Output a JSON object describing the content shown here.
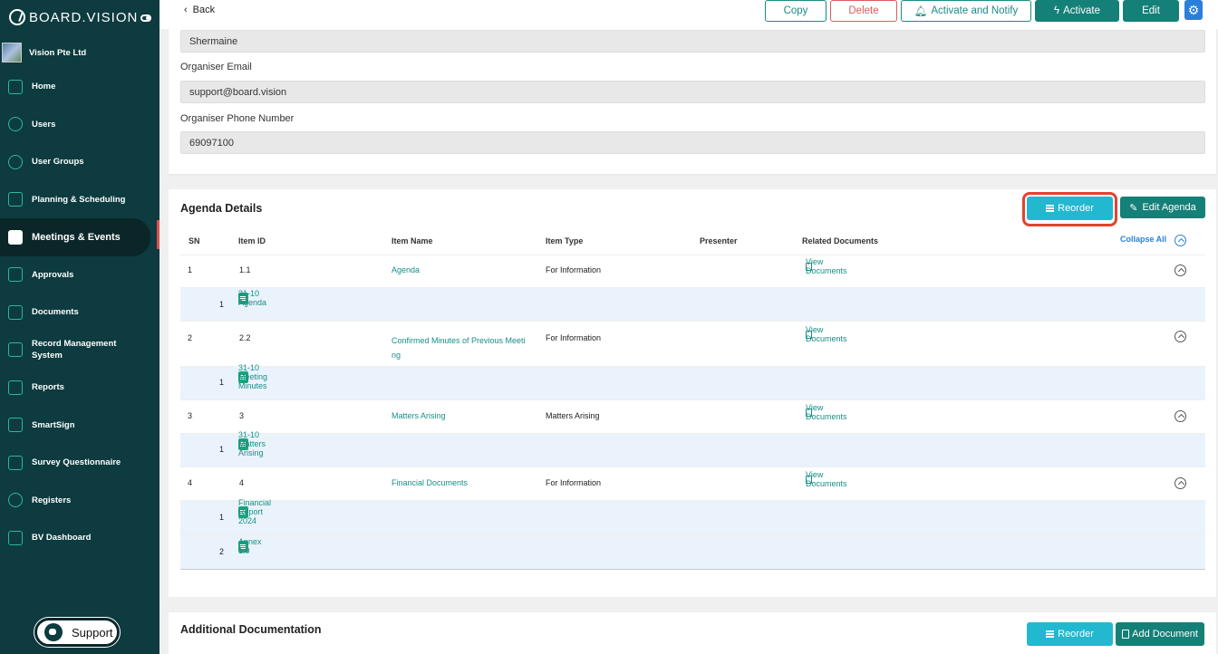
{
  "sidebar": {
    "logo": "BOARD.VISION",
    "org": "Vision Pte Ltd",
    "items": [
      {
        "label": "Home",
        "icon": "home-icon"
      },
      {
        "label": "Users",
        "icon": "user-icon"
      },
      {
        "label": "User Groups",
        "icon": "user-group-icon"
      },
      {
        "label": "Planning & Scheduling",
        "icon": "chart-icon"
      },
      {
        "label": "Meetings & Events",
        "icon": "calendar-icon"
      },
      {
        "label": "Approvals",
        "icon": "document-icon"
      },
      {
        "label": "Documents",
        "icon": "documents-icon"
      },
      {
        "label": "Record Management System",
        "icon": "records-icon"
      },
      {
        "label": "Reports",
        "icon": "report-icon"
      },
      {
        "label": "SmartSign",
        "icon": "signature-icon"
      },
      {
        "label": "Survey Questionnaire",
        "icon": "survey-icon"
      },
      {
        "label": "Registers",
        "icon": "registered-icon"
      },
      {
        "label": "BV Dashboard",
        "icon": "dashboard-icon"
      }
    ],
    "support_label": "Support"
  },
  "topbar": {
    "back_label": "Back",
    "copy_label": "Copy",
    "delete_label": "Delete",
    "notify_label": "Activate and Notify",
    "activate_label": "Activate",
    "edit_label": "Edit"
  },
  "organiser": {
    "name_value": "Shermaine",
    "email_label": "Organiser Email",
    "email_value": "support@board.vision",
    "phone_label": "Organiser Phone Number",
    "phone_value": "69097100"
  },
  "agenda": {
    "title": "Agenda Details",
    "reorder_label": "Reorder",
    "edit_label": "Edit Agenda",
    "collapse_label": "Collapse All",
    "columns": [
      "SN",
      "Item ID",
      "Item Name",
      "Item Type",
      "Presenter",
      "Related Documents"
    ],
    "view_docs_label": "View Documents",
    "rows": [
      {
        "sn": "1",
        "id": "1.1",
        "name": "Agenda",
        "type": "For Information",
        "docs": [
          {
            "n": "1",
            "name": "31-10 Agenda"
          }
        ]
      },
      {
        "sn": "2",
        "id": "2.2",
        "name": "Confirmed Minutes of Previous Meeti",
        "name2": "ng",
        "type": "For Information",
        "docs": [
          {
            "n": "1",
            "name": "31-10 Meeting Minutes"
          }
        ]
      },
      {
        "sn": "3",
        "id": "3",
        "name": "Matters Arising",
        "type": "Matters Arising",
        "docs": [
          {
            "n": "1",
            "name": "31-10 Matters Arising"
          }
        ]
      },
      {
        "sn": "4",
        "id": "4",
        "name": "Financial Documents",
        "type": "For Information",
        "docs": [
          {
            "n": "1",
            "name": "Financial Report 2024"
          },
          {
            "n": "2",
            "name": "Annex 1.0"
          }
        ]
      }
    ]
  },
  "additional": {
    "title": "Additional Documentation",
    "reorder_label": "Reorder",
    "add_label": "Add Document"
  },
  "colors": {
    "sidebar": "#0d3b3f",
    "primary": "#148078",
    "accent": "#22b8d0",
    "danger": "#e05a5a",
    "link": "#178f86"
  }
}
